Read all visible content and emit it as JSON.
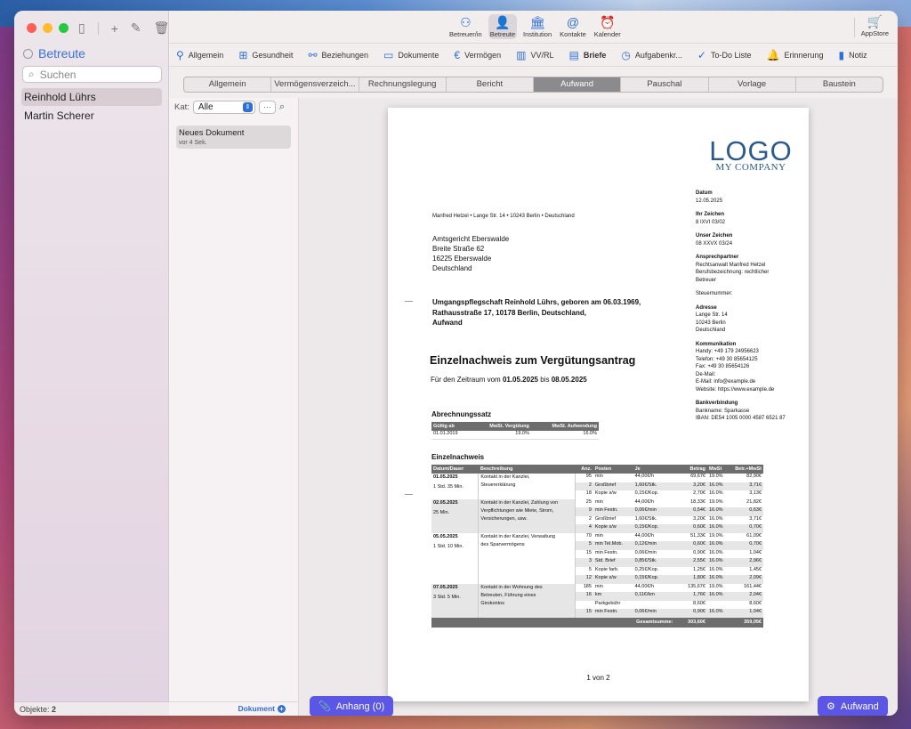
{
  "sidebar": {
    "section_title": "Betreute",
    "search_placeholder": "Suchen",
    "items": [
      {
        "label": "Reinhold Lührs"
      },
      {
        "label": "Martin Scherer"
      }
    ],
    "footer_label": "Objekte:",
    "footer_count": "2"
  },
  "toolbar": {
    "buttons": [
      {
        "label": "Betreuer/in",
        "icon": "person-tree-icon"
      },
      {
        "label": "Betreute",
        "icon": "person-icon"
      },
      {
        "label": "Institution",
        "icon": "building-icon"
      },
      {
        "label": "Kontakte",
        "icon": "contact-at-icon"
      },
      {
        "label": "Kalender",
        "icon": "alarm-clock-icon"
      }
    ],
    "appstore_label": "AppStore"
  },
  "nav": {
    "items": [
      {
        "label": "Allgemein"
      },
      {
        "label": "Gesundheit"
      },
      {
        "label": "Beziehungen"
      },
      {
        "label": "Dokumente"
      },
      {
        "label": "Vermögen"
      },
      {
        "label": "VV/RL"
      },
      {
        "label": "Briefe"
      },
      {
        "label": "Aufgabenkr..."
      },
      {
        "label": "To-Do Liste"
      },
      {
        "label": "Erinnerung"
      },
      {
        "label": "Notiz"
      }
    ]
  },
  "segments": [
    {
      "label": "Allgemein"
    },
    {
      "label": "Vermögensverzeich..."
    },
    {
      "label": "Rechnungslegung"
    },
    {
      "label": "Bericht"
    },
    {
      "label": "Aufwand"
    },
    {
      "label": "Pauschal"
    },
    {
      "label": "Vorlage"
    },
    {
      "label": "Baustein"
    }
  ],
  "doclist": {
    "kat_label": "Kat:",
    "kat_value": "Alle",
    "more_label": "···",
    "card_title": "Neues Dokument",
    "card_sub": "vor 4 Sek.",
    "footer_label": "Dokument"
  },
  "letter": {
    "logo_main": "LOGO",
    "logo_sub": "MY COMPANY",
    "sender_line": "Manfred Hetzel • Lange Str. 14 • 10243 Berlin • Deutschland",
    "recipient": [
      "Amtsgericht Eberswalde",
      "Breite Straße 62",
      "16225 Eberswalde",
      "Deutschland"
    ],
    "subject": [
      "Umgangspflegschaft Reinhold Lührs, geboren am 06.03.1969,",
      "Rathausstraße 17, 10178 Berlin, Deutschland,",
      "Aufwand"
    ],
    "heading": "Einzelnachweis zum Vergütungsantrag",
    "period_pre": "Für den Zeitraum vom",
    "period_from": "01.05.2025",
    "period_mid": "bis",
    "period_to": "08.05.2025",
    "info": {
      "datum_label": "Datum",
      "datum": "12.05.2025",
      "ihr_label": "Ihr Zeichen",
      "ihr": "8 IXVI 03/02",
      "unser_label": "Unser Zeichen",
      "unser": "08 XXVX 03/24",
      "ansp_label": "Ansprechpartner",
      "ansp1": "Rechtsanwalt Manfred Hetzel",
      "ansp2": "Berufsbezeichnung: rechtlicher",
      "ansp3": "Betreuer",
      "steuer": "Steuernummer:",
      "adr_label": "Adresse",
      "adr1": "Lange Str. 14",
      "adr2": "10243 Berlin",
      "adr3": "Deutschland",
      "kom_label": "Kommunikation",
      "kom1": "Handy: +49 179 24956623",
      "kom2": "Telefon: +49 30 85654125",
      "kom3": "Fax: +49 30 85654126",
      "kom4": "De-Mail:",
      "kom5": "E-Mail: info@example.de",
      "kom6": "Website: https://www.example.de",
      "bank_label": "Bankverbindung",
      "bank1": "Bankname: Sparkasse",
      "bank2": "IBAN: DE54 1005 0000 4587 6521 87"
    },
    "rate_heading": "Abrechnungssatz",
    "rate_headers": [
      "Gültig ab",
      "MwSt. Vergütung",
      "MwSt. Aufwendung"
    ],
    "rate_row": [
      "01.01.2019",
      "19.0%",
      "16.0%"
    ],
    "detail_heading": "Einzelnachweis",
    "detail_headers": [
      "Datum/Dauer",
      "Beschreibung",
      "Anz.",
      "Posten",
      "Je",
      "Betrag",
      "MwSt",
      "Betr.+MwSt"
    ],
    "groups": [
      {
        "date": "01.05.2025",
        "dur": "1 Std. 35 Min.",
        "desc": [
          "Kontakt in der Kanzlei,",
          "Steuererklärung"
        ],
        "rows": [
          [
            "95",
            "min",
            "44,00€/h",
            "69,67€",
            "19.0%",
            "82,90€"
          ],
          [
            "2",
            "Großbrief",
            "1,60€/Stk.",
            "3,20€",
            "16.0%",
            "3,71€"
          ],
          [
            "18",
            "Kopie s/w",
            "0,15€/Kop.",
            "2,70€",
            "16.0%",
            "3,13€"
          ]
        ]
      },
      {
        "date": "02.05.2025",
        "dur": "25 Min.",
        "desc": [
          "Kontakt in der Kanzlei, Zahlung von",
          "Verpflichtungen wie Miete, Strom,",
          "Versicherungen, usw."
        ],
        "rows": [
          [
            "25",
            "min",
            "44,00€/h",
            "18,33€",
            "19.0%",
            "21,82€"
          ],
          [
            "9",
            "min Festn.",
            "0,06€/min",
            "0,54€",
            "16.0%",
            "0,63€"
          ],
          [
            "2",
            "Großbrief",
            "1,60€/Stk.",
            "3,20€",
            "16.0%",
            "3,71€"
          ],
          [
            "4",
            "Kopie s/w",
            "0,15€/Kop.",
            "0,60€",
            "16.0%",
            "0,70€"
          ]
        ]
      },
      {
        "date": "05.05.2025",
        "dur": "1 Std. 10 Min.",
        "desc": [
          "Kontakt in der Kanzlei, Verwaltung",
          "des Sparvermögens"
        ],
        "rows": [
          [
            "70",
            "min",
            "44,00€/h",
            "51,33€",
            "19.0%",
            "61,09€"
          ],
          [
            "5",
            "min Tel.Mob.",
            "0,12€/min",
            "0,60€",
            "16.0%",
            "0,70€"
          ],
          [
            "15",
            "min Festn.",
            "0,06€/min",
            "0,90€",
            "16.0%",
            "1,04€"
          ],
          [
            "3",
            "Std. Brief",
            "0,85€/Stk.",
            "2,55€",
            "16.0%",
            "2,96€"
          ],
          [
            "5",
            "Kopie farb.",
            "0,25€/Kop.",
            "1,25€",
            "16.0%",
            "1,45€"
          ],
          [
            "12",
            "Kopie s/w",
            "0,15€/Kop.",
            "1,80€",
            "16.0%",
            "2,09€"
          ]
        ]
      },
      {
        "date": "07.05.2025",
        "dur": "3 Std. 5 Min.",
        "desc": [
          "Kontakt in der Wohnung des",
          "Betreuten, Führung eines",
          "Girokontos"
        ],
        "rows": [
          [
            "185",
            "min",
            "44,00€/h",
            "135,67€",
            "19.0%",
            "161,44€"
          ],
          [
            "16",
            "km",
            "0,11€/km",
            "1,76€",
            "16.0%",
            "2,04€"
          ],
          [
            "",
            "Parkgebühr",
            "",
            "8,60€",
            "",
            "8,60€"
          ],
          [
            "15",
            "min Festn.",
            "0,06€/min",
            "0,90€",
            "16.0%",
            "1,04€"
          ]
        ]
      }
    ],
    "sum_label": "Gesamtsumme:",
    "sum_net": "303,60€",
    "sum_gross": "359,05€",
    "page": "1 von 2"
  },
  "buttons": {
    "attach_label": "Anhang (0)",
    "aufwand_label": "Aufwand"
  }
}
